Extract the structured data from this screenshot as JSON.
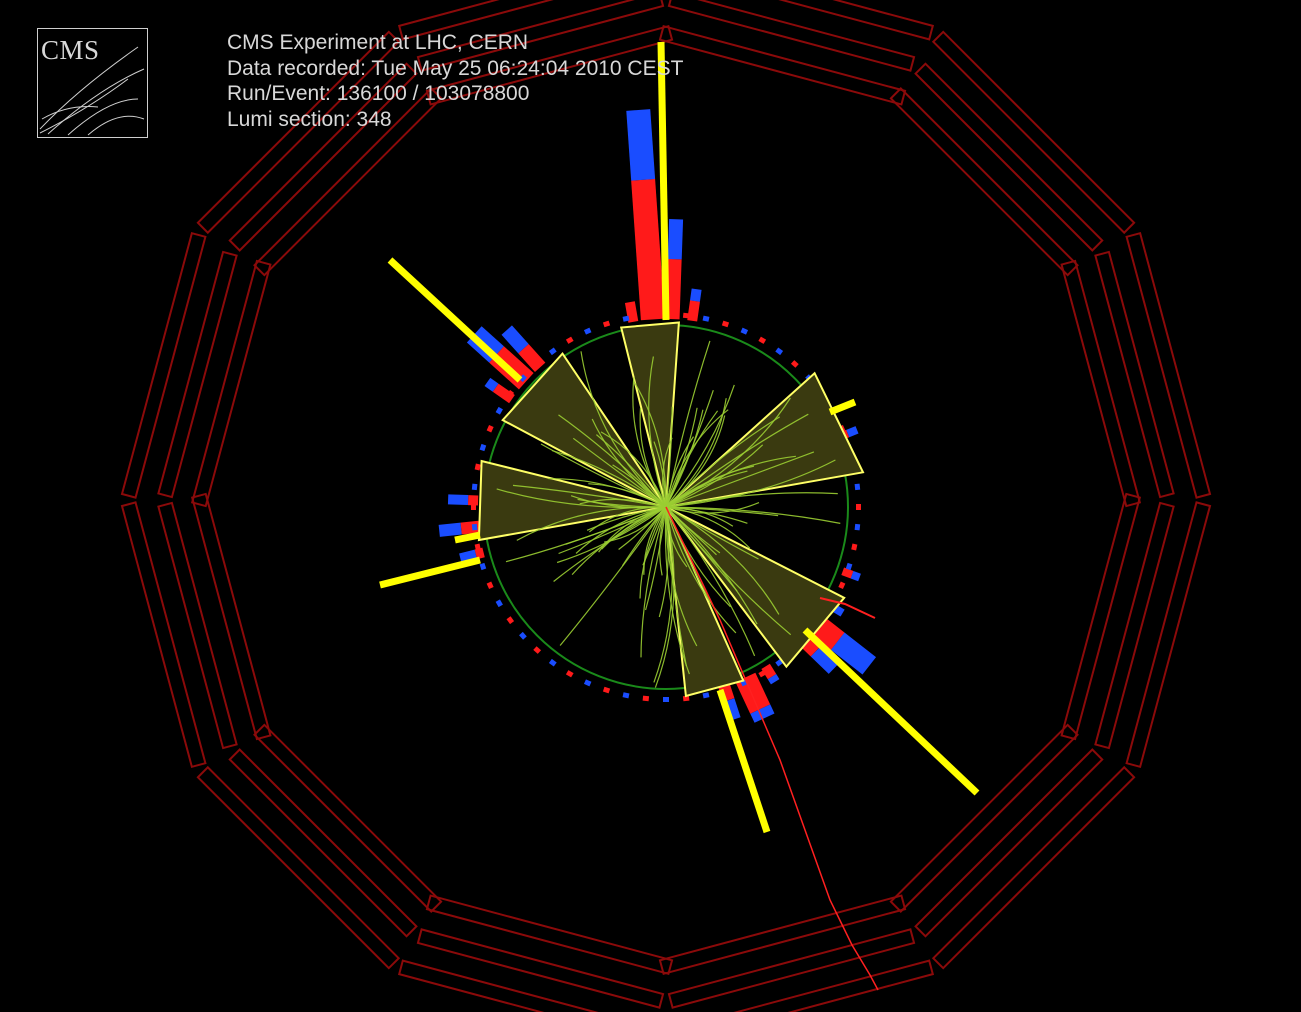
{
  "logo": {
    "text": "CMS"
  },
  "event_info": {
    "line1": "CMS Experiment at LHC, CERN",
    "line2": "Data recorded: Tue May 25 06:24:04 2010 CEST",
    "line3": "Run/Event: 136100 / 103078800",
    "line4": "Lumi section: 348"
  },
  "colors": {
    "background": "#000000",
    "muon_chambers": "#8b0a0a",
    "jet_cone": "#ffff66",
    "jet_cone_fill": "#3a3a10",
    "jet_axis": "#ffff00",
    "tracks": "#9acd32",
    "ecal": "#ff1a1a",
    "hcal": "#1a4dff",
    "tracker_boundary": "#1a8a1a",
    "muon_track": "#ff2020",
    "text": "#d8d8d8"
  }
}
